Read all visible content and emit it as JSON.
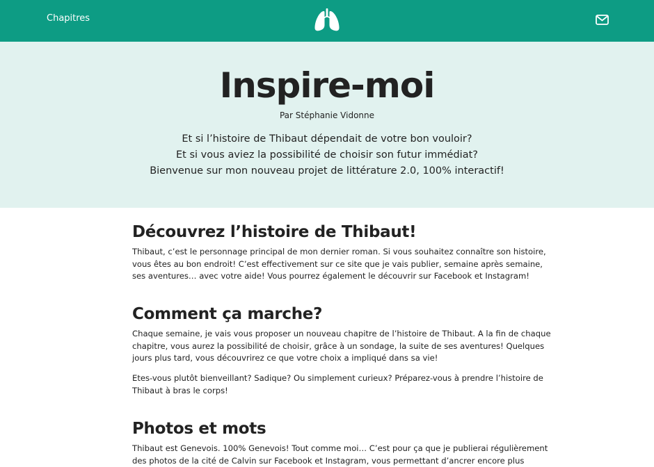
{
  "nav": {
    "chapters_label": "Chapitres",
    "logo_icon": "lungs-icon",
    "contact_icon": "mail-icon",
    "brand_color": "#0d9c84"
  },
  "hero": {
    "title": "Inspire-moi",
    "author": "Par Stéphanie Vidonne",
    "lines": [
      "Et si l’histoire de Thibaut dépendait de votre bon vouloir?",
      "Et si vous aviez la possibilité de choisir son futur immédiat?",
      "Bienvenue sur mon nouveau projet de littérature 2.0, 100% interactif!"
    ],
    "background_color": "#e1f2ef"
  },
  "sections": [
    {
      "title": "Découvrez l’histoire de Thibaut!",
      "paragraphs": [
        [
          "Thibaut, c’est le personnage principal de mon dernier roman. Si vous souhaitez connaître son histoire,",
          "vous êtes au bon endroit! C’est effectivement sur ce site que je vais publier, semaine après semaine,",
          "ses aventures… avec votre aide! Vous pourrez également le découvrir sur Facebook et Instagram!"
        ]
      ]
    },
    {
      "title": "Comment ça marche?",
      "paragraphs": [
        [
          "Chaque semaine, je vais vous proposer un nouveau chapitre de l’histoire de Thibaut. A la fin de chaque",
          "chapitre, vous aurez la possibilité de choisir, grâce à un sondage, la suite de ses aventures! Quelques",
          "jours plus tard, vous découvrirez ce que votre choix a impliqué dans sa vie!"
        ],
        [
          "Etes-vous plutôt bienveillant? Sadique? Ou simplement curieux? Préparez-vous à prendre l’histoire de",
          "Thibaut à bras le corps!"
        ]
      ]
    },
    {
      "title": "Photos et mots",
      "paragraphs": [
        [
          "Thibaut est Genevois. 100% Genevois! Tout comme moi… C’est pour ça que je publierai régulièrement",
          "des photos de la cité de Calvin sur Facebook et Instagram, vous permettant d’ancrer encore plus"
        ]
      ]
    }
  ]
}
